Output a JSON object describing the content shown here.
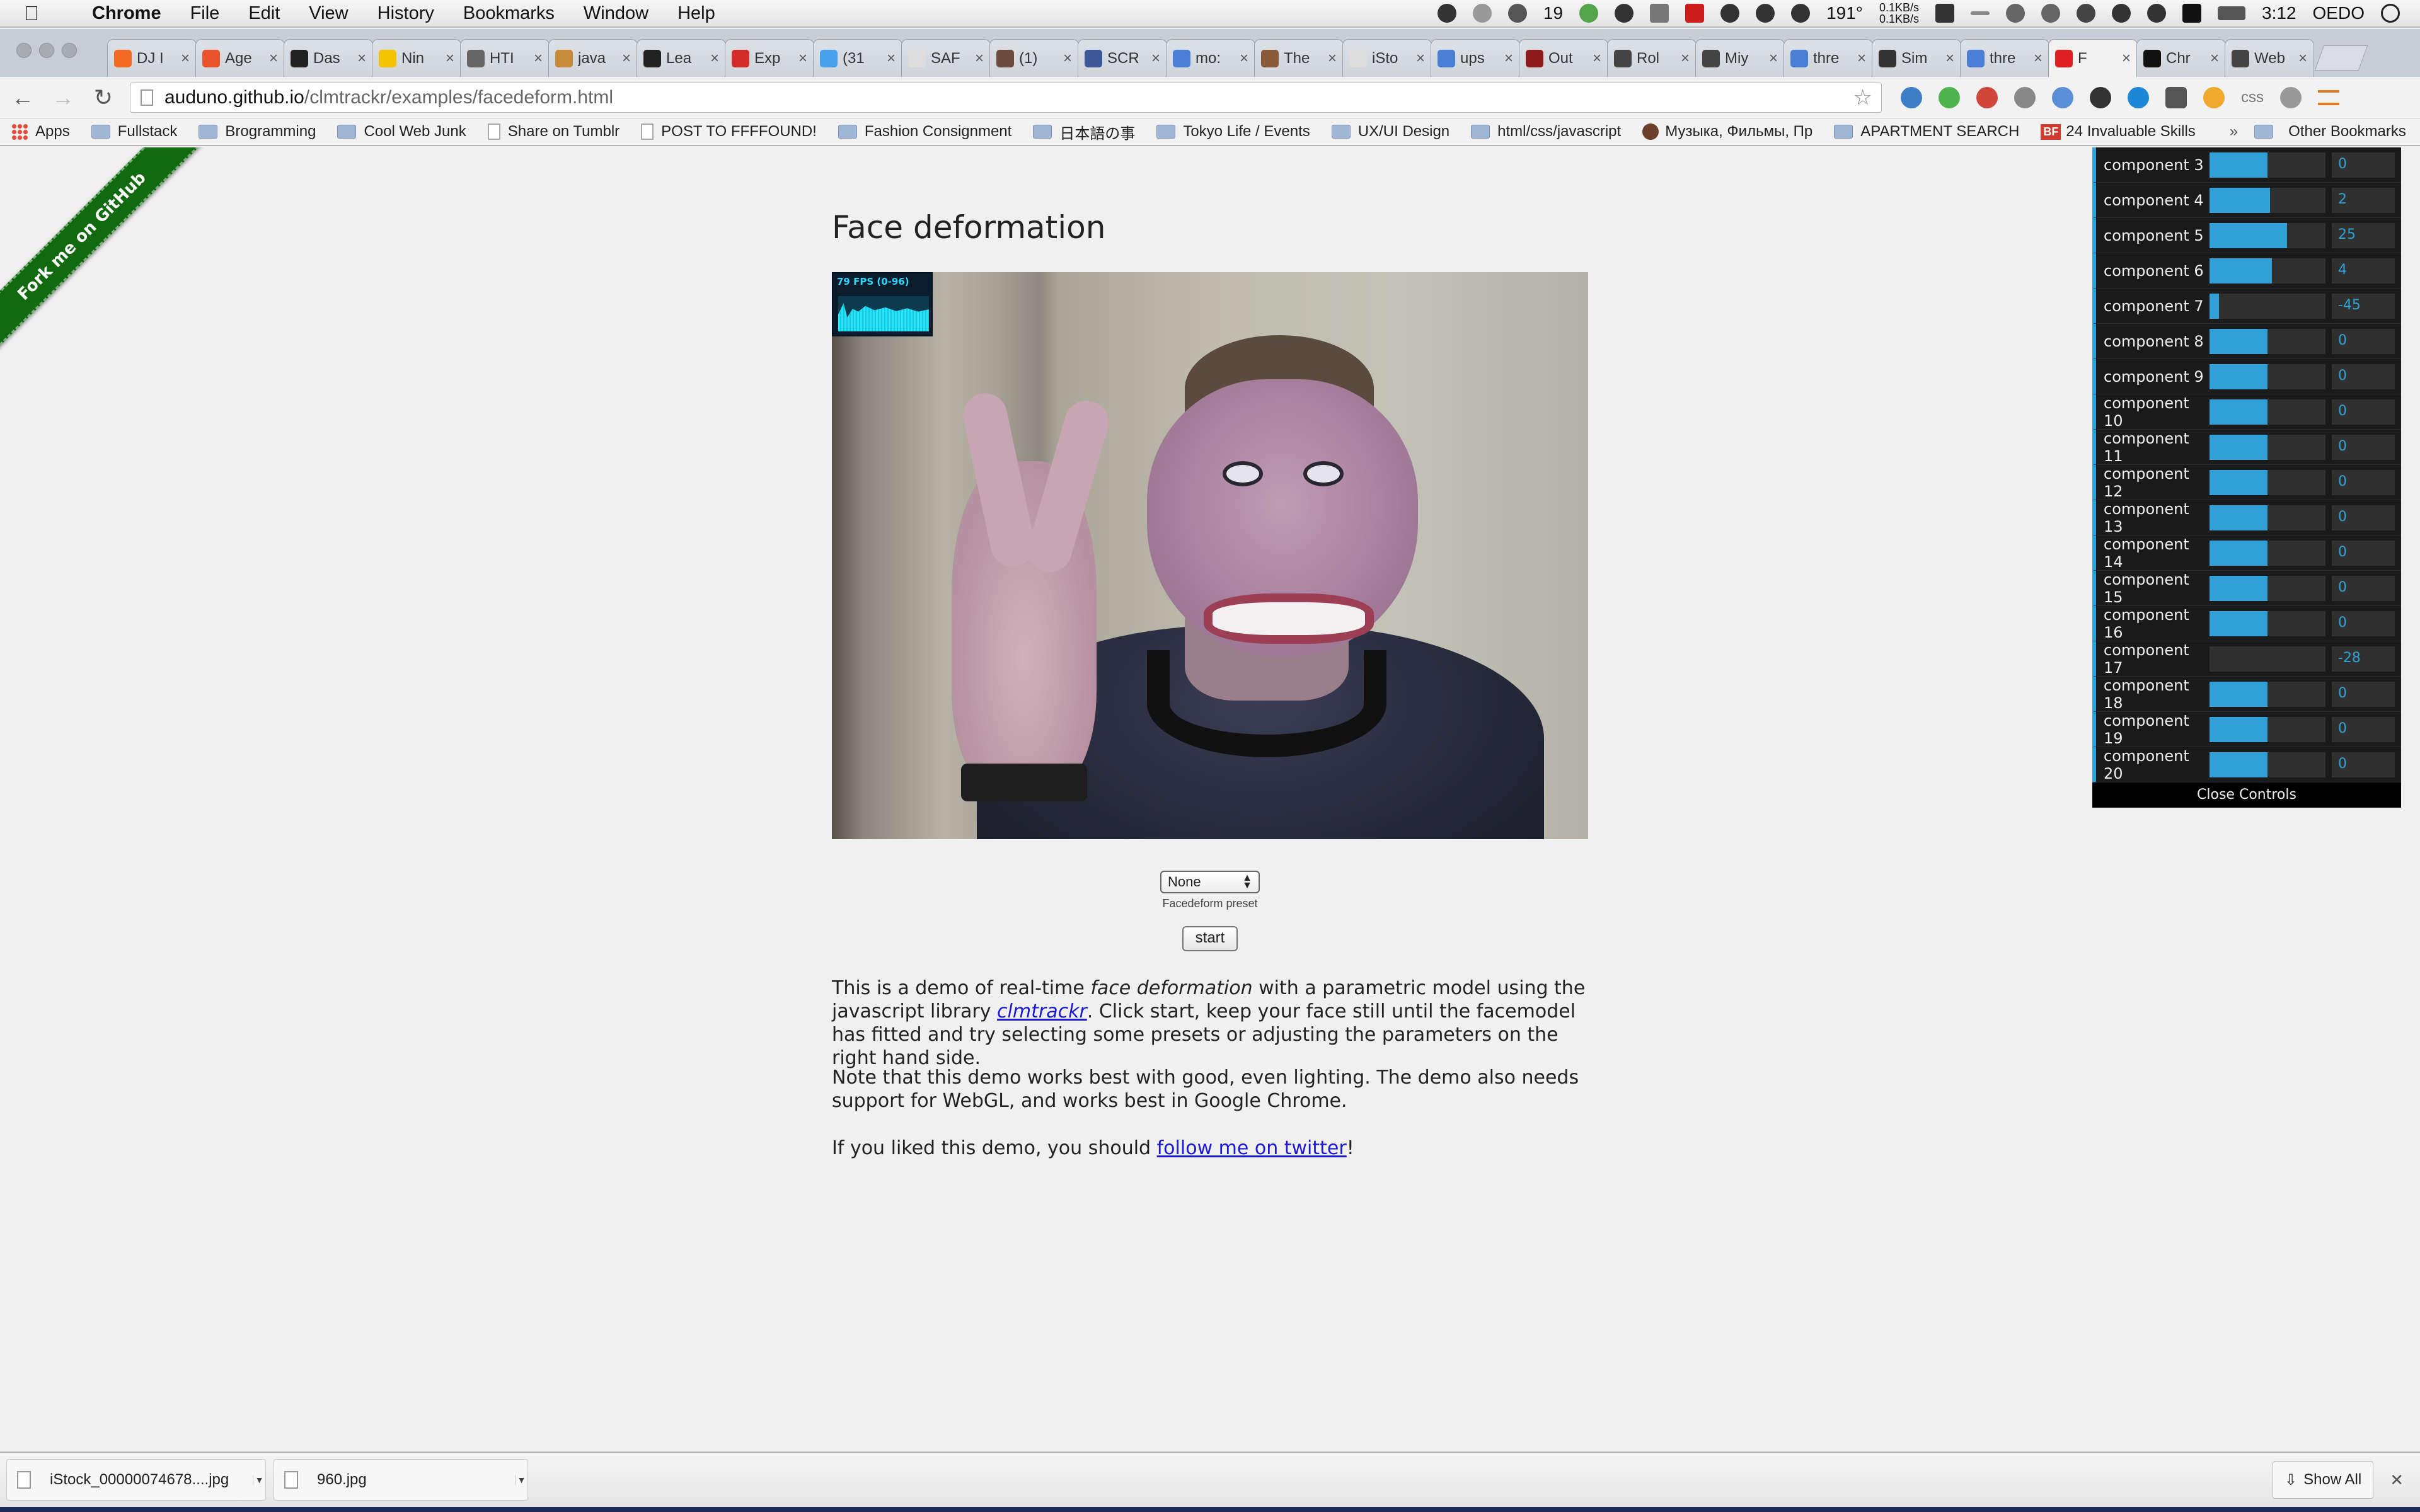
{
  "menubar": {
    "app_name": "Chrome",
    "items": [
      "File",
      "Edit",
      "View",
      "History",
      "Bookmarks",
      "Window",
      "Help"
    ],
    "status": {
      "badge_count": "19",
      "temperature": "191°",
      "net_up": "0.1KB/s",
      "net_down": "0.1KB/s",
      "time": "3:12",
      "user": "OEDO"
    }
  },
  "tabs": [
    {
      "title": "DJ I",
      "icon_color": "#f26b22"
    },
    {
      "title": "Age",
      "icon_color": "#e9542f"
    },
    {
      "title": "Das",
      "icon_color": "#222222"
    },
    {
      "title": "Nin",
      "icon_color": "#f5c400"
    },
    {
      "title": "HTI",
      "icon_color": "#666666"
    },
    {
      "title": "java",
      "icon_color": "#c88b3a"
    },
    {
      "title": "Lea",
      "icon_color": "#222222"
    },
    {
      "title": "Exp",
      "icon_color": "#d42b2b"
    },
    {
      "title": "(31",
      "icon_color": "#4aa1eb"
    },
    {
      "title": "SAF",
      "icon_color": "#dddddd"
    },
    {
      "title": "(1)",
      "icon_color": "#6b4b3b"
    },
    {
      "title": "SCR",
      "icon_color": "#3b5998"
    },
    {
      "title": "mo:",
      "icon_color": "#4a7fd6"
    },
    {
      "title": "The",
      "icon_color": "#8a5a3a"
    },
    {
      "title": "iSto",
      "icon_color": "#dddddd"
    },
    {
      "title": "ups",
      "icon_color": "#4a7fd6"
    },
    {
      "title": "Out",
      "icon_color": "#8e1b1b"
    },
    {
      "title": "Rol",
      "icon_color": "#444444"
    },
    {
      "title": "Miy",
      "icon_color": "#444444"
    },
    {
      "title": "thre",
      "icon_color": "#4a7fd6"
    },
    {
      "title": "Sim",
      "icon_color": "#333333"
    },
    {
      "title": "thre",
      "icon_color": "#4a7fd6"
    },
    {
      "title": "F",
      "icon_color": "#e02020",
      "active": true
    },
    {
      "title": "Chr",
      "icon_color": "#111111"
    },
    {
      "title": "Web",
      "icon_color": "#444444"
    }
  ],
  "toolbar": {
    "url_host": "auduno.github.io",
    "url_path": "/clmtrackr/examples/facedeform.html",
    "ext_label_css": "css"
  },
  "bookmarks": {
    "items": [
      {
        "label": "Apps",
        "kind": "apps"
      },
      {
        "label": "Fullstack",
        "kind": "folder"
      },
      {
        "label": "Brogramming",
        "kind": "folder"
      },
      {
        "label": "Cool Web Junk",
        "kind": "folder"
      },
      {
        "label": "Share on Tumblr",
        "kind": "page"
      },
      {
        "label": "POST TO FFFFOUND!",
        "kind": "page"
      },
      {
        "label": "Fashion Consignment",
        "kind": "folder"
      },
      {
        "label": "日本語の事",
        "kind": "folder"
      },
      {
        "label": "Tokyo Life / Events",
        "kind": "folder"
      },
      {
        "label": "UX/UI Design",
        "kind": "folder"
      },
      {
        "label": "html/css/javascript",
        "kind": "folder"
      },
      {
        "label": "Музыка, Фильмы, Пр",
        "kind": "skull"
      },
      {
        "label": "APARTMENT SEARCH",
        "kind": "folder"
      },
      {
        "label": "24 Invaluable Skills",
        "kind": "bf"
      }
    ],
    "bf_badge": "BF",
    "more": "»",
    "other": "Other Bookmarks"
  },
  "page": {
    "ribbon": "Fork me on GitHub",
    "title": "Face deformation",
    "fps_label": "79 FPS (0-96)",
    "preset": {
      "selected": "None",
      "caption": "Facedeform preset"
    },
    "start_label": "start",
    "para1": {
      "a": "This is a demo of real-time ",
      "em": "face deformation",
      "b": " with a parametric model using the javascript library ",
      "link": "clmtrackr",
      "c": ". Click start, keep your face still until the facemodel has fitted and try selecting some presets or adjusting the parameters on the right hand side."
    },
    "para2": "Note that this demo works best with good, even lighting. The demo also needs support for WebGL, and works best in Google Chrome.",
    "para3": {
      "a": "If you liked this demo, you should ",
      "link": "follow me on twitter",
      "b": "!"
    }
  },
  "controls": {
    "rows": [
      {
        "label": "component 3",
        "value": "0",
        "level": 0.5
      },
      {
        "label": "component 4",
        "value": "2",
        "level": 0.52
      },
      {
        "label": "component 5",
        "value": "25",
        "level": 0.67
      },
      {
        "label": "component 6",
        "value": "4",
        "level": 0.54
      },
      {
        "label": "component 7",
        "value": "-45",
        "level": 0.08
      },
      {
        "label": "component 8",
        "value": "0",
        "level": 0.5
      },
      {
        "label": "component 9",
        "value": "0",
        "level": 0.5
      },
      {
        "label": "component 10",
        "value": "0",
        "level": 0.5
      },
      {
        "label": "component 11",
        "value": "0",
        "level": 0.5
      },
      {
        "label": "component 12",
        "value": "0",
        "level": 0.5
      },
      {
        "label": "component 13",
        "value": "0",
        "level": 0.5
      },
      {
        "label": "component 14",
        "value": "0",
        "level": 0.5
      },
      {
        "label": "component 15",
        "value": "0",
        "level": 0.5
      },
      {
        "label": "component 16",
        "value": "0",
        "level": 0.5
      },
      {
        "label": "component 17",
        "value": "-28",
        "level": 0.0
      },
      {
        "label": "component 18",
        "value": "0",
        "level": 0.5
      },
      {
        "label": "component 19",
        "value": "0",
        "level": 0.5
      },
      {
        "label": "component 20",
        "value": "0",
        "level": 0.5
      }
    ],
    "close_label": "Close Controls",
    "accent": "#2fa1d6"
  },
  "downloads": {
    "items": [
      "iStock_00000074678....jpg",
      "960.jpg"
    ],
    "show_all": "Show All"
  }
}
